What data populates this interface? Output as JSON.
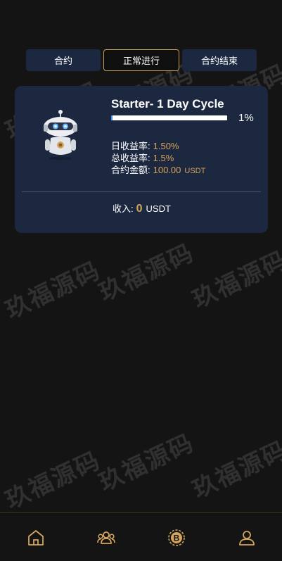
{
  "tabs": [
    {
      "label": "合约",
      "active": false
    },
    {
      "label": "正常进行",
      "active": true
    },
    {
      "label": "合约结束",
      "active": false
    }
  ],
  "contract": {
    "title": "Starter- 1 Day Cycle",
    "progress_percent": 1,
    "progress_text": "1%",
    "daily_rate_label": "日收益率:",
    "daily_rate_value": "1.50%",
    "total_rate_label": "总收益率:",
    "total_rate_value": "1.5%",
    "amount_label": "合约金额:",
    "amount_value": "100.00",
    "amount_unit": "USDT",
    "income_label": "收入:",
    "income_value": "0",
    "income_unit": "USDT"
  },
  "watermark_text": "玖福源码",
  "nav": [
    {
      "icon": "home-icon"
    },
    {
      "icon": "team-icon"
    },
    {
      "icon": "bitcoin-icon"
    },
    {
      "icon": "user-icon"
    }
  ],
  "colors": {
    "background": "#141414",
    "card": "#1c2840",
    "accent": "#d4a55c",
    "progress": "#3a8fe8"
  }
}
